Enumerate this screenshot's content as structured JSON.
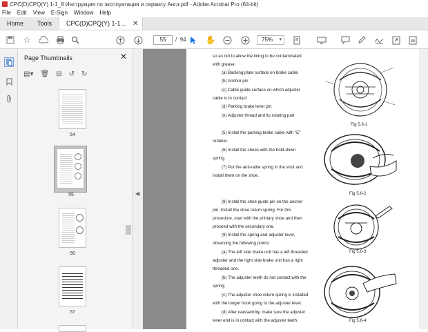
{
  "window": {
    "title": "CPC(D)CPQ(Y) 1-1_8 Инструкция по эксплуатации и сервису Англ.pdf - Adobe Acrobat Pro (64-bit)"
  },
  "menu": [
    "File",
    "Edit",
    "View",
    "E-Sign",
    "Window",
    "Help"
  ],
  "tabs": {
    "home": "Home",
    "tools": "Tools",
    "document": "CPC(D)CPQ(Y) 1-1..."
  },
  "toolbar": {
    "current_page": "55",
    "separator": "/",
    "total_pages": "94",
    "zoom": "75%"
  },
  "panel": {
    "title": "Page Thumbnails",
    "thumbnails": [
      "54",
      "55",
      "56",
      "57"
    ]
  },
  "page": {
    "lines": [
      "so as not to allow the lining to be contaminated",
      "with grease.",
      "(a) Backing plate surface on brake cable",
      "(b) Anchor pin",
      "(c) Cable guide surface on which adjuster",
      "cable is to contact",
      "(d) Parking brake lever pin",
      "(e) Adjuster thread and its rotating part",
      "(5) Install the parking brake cable with \"E\"",
      "retainer.",
      "(6) Install the shoes with the hold-down",
      "spring.",
      "(7) Put the anti-rattle spring in the strut and",
      "install them on the shoe.",
      "(8) Install the shoe guide pin on the anchor",
      "pin. Install the shoe return spring. For this",
      "procedure, start with the primary shoe and then",
      "proceed with the secondary one.",
      "(9) Install the spring and adjuster lever,",
      "observing the following points:",
      "(a) The left side brake unit has a left threaded",
      "adjuster and the right side brake unit has a right",
      "threaded one.",
      "(b) The adjuster teeth do not contact with the",
      "spring.",
      "(c) The adjuster shoe return spring is installed",
      "with the longer hook going to the adjuster lever.",
      "(d) After reassembly, make sure the adjuster",
      "lever end is in contact with the adjuster teeth."
    ],
    "figures": [
      "Fig 5.6-1",
      "Fig 5.6-2",
      "Fig 5.6-3",
      "Fig 5.6-4"
    ]
  }
}
